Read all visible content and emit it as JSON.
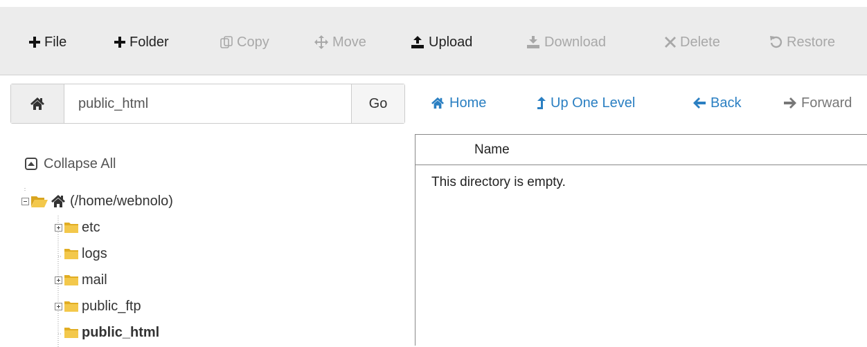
{
  "toolbar": {
    "buttons": [
      {
        "label": "File",
        "icon": "plus-icon",
        "enabled": true
      },
      {
        "label": "Folder",
        "icon": "plus-icon",
        "enabled": true
      },
      {
        "label": "Copy",
        "icon": "copy-icon",
        "enabled": false
      },
      {
        "label": "Move",
        "icon": "move-icon",
        "enabled": false
      },
      {
        "label": "Upload",
        "icon": "upload-icon",
        "enabled": true
      },
      {
        "label": "Download",
        "icon": "download-icon",
        "enabled": false
      },
      {
        "label": "Delete",
        "icon": "delete-icon",
        "enabled": false
      },
      {
        "label": "Restore",
        "icon": "restore-icon",
        "enabled": false
      }
    ]
  },
  "pathbar": {
    "home_icon": "home-icon",
    "path_value": "public_html",
    "go_label": "Go"
  },
  "nav": {
    "home": "Home",
    "up_one_level": "Up One Level",
    "back": "Back",
    "forward": "Forward"
  },
  "tree": {
    "collapse_all": "Collapse All",
    "root": "(/home/webnolo)",
    "children": [
      {
        "label": "etc",
        "expandable": true
      },
      {
        "label": "logs",
        "expandable": false
      },
      {
        "label": "mail",
        "expandable": true
      },
      {
        "label": "public_ftp",
        "expandable": true
      },
      {
        "label": "public_html",
        "expandable": false,
        "selected": true
      }
    ]
  },
  "files": {
    "column_name": "Name",
    "empty_message": "This directory is empty."
  },
  "colors": {
    "link": "#2a7fc2",
    "folder": "#f0c040",
    "toolbar_bg": "#ececec"
  }
}
